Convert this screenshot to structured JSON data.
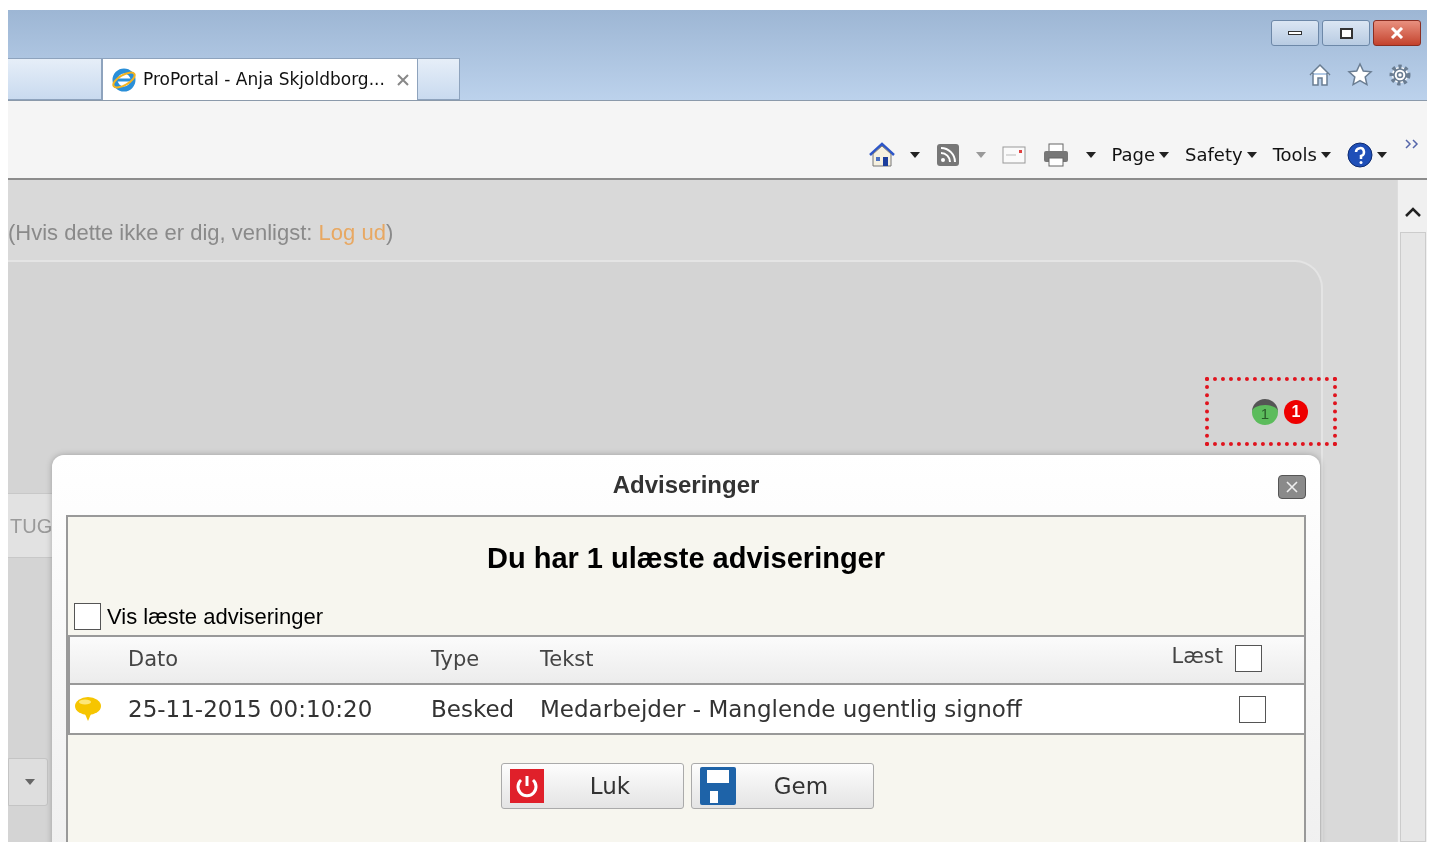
{
  "browser": {
    "tabs": [
      {
        "title": "ProPortal - Anja Skjoldborg...",
        "selected": true
      }
    ],
    "command_bar": {
      "menus": [
        "Page",
        "Safety",
        "Tools"
      ]
    }
  },
  "page": {
    "logout_line": {
      "text": "(Hvis dette ikke er dig, venligst: ",
      "link": "Log ud",
      "closing": ")"
    },
    "notification": {
      "count": "1",
      "badge": "1"
    },
    "side_tab": "TUG"
  },
  "dialog": {
    "title": "Adviseringer",
    "heading": "Du har 1 ulæste adviseringer",
    "show_read": {
      "label": "Vis læste adviseringer",
      "checked": false
    },
    "table": {
      "columns": [
        "Dato",
        "Type",
        "Tekst",
        "Læst"
      ],
      "all_read": false,
      "rows": [
        {
          "kind": "message",
          "date": "25-11-2015 00:10:20",
          "type": "Besked",
          "text": "Medarbejder - Manglende ugentlig signoff",
          "read": false
        }
      ]
    },
    "buttons": [
      {
        "kind": "close",
        "label": "Luk"
      },
      {
        "kind": "save",
        "label": "Gem"
      }
    ]
  }
}
